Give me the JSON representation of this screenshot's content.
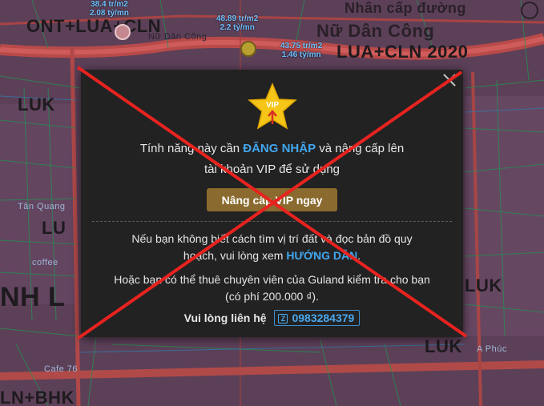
{
  "map": {
    "zone_labels": {
      "ont_lua_cln": "ONT+LUA+CLN",
      "lua_cln_2020": "LUA+CLN 2020",
      "luk_left": "LUK",
      "luk_right": "LUK",
      "luk_left_mid": "LU",
      "luk_bottom": "LUK",
      "nh_l": "NH L",
      "ln_bhk": "LN+BHK"
    },
    "street_labels": {
      "nu_dan_cong": "Nữ Dân Công",
      "nu_dan_cong_small": "Nữ Dân Công",
      "nhan_cap_duong": "Nhân cấp đường",
      "tan_quang": "Tân Quang",
      "cafe_76": "Cafe 76",
      "coffee": "coffee",
      "phuc": "A Phúc"
    },
    "prices": [
      {
        "per_m2": "38.4 tr/m2",
        "total": "2.08 tỷ/mn"
      },
      {
        "per_m2": "48.89 tr/m2",
        "total": "2.2 tỷ/mn"
      },
      {
        "per_m2": "43.75 tr/m2",
        "total": "1.46 tỷ/mn"
      }
    ]
  },
  "modal": {
    "vip_badge": "VIP",
    "message_prefix": "Tính năng này cần ",
    "login_link": "ĐĂNG NHẬP",
    "message_middle": " và nâng cấp lên",
    "message_line2": "tài khoản VIP để sử dụng",
    "upgrade_button": "Nâng cấp VIP ngay",
    "info_line1": "Nếu bạn không biết cách tìm vị trí đất và đọc bản đồ quy",
    "info_line2_prefix": "hoạch, vui lòng xem ",
    "guide_link": "HƯỚNG DẪN",
    "info_line2_suffix": ".",
    "info_line3": "Hoặc bạn có thể thuê chuyên viên của Guland kiểm tra cho bạn",
    "info_line4": "(có phí 200.000 ₫).",
    "contact_label": "Vui lòng liên hệ",
    "zalo_icon_label": "Z",
    "phone": "0983284379"
  },
  "colors": {
    "link": "#41a7ef",
    "upgrade_button_bg": "#8a6a2e",
    "modal_bg": "#232222",
    "cross_mark": "#e8231f",
    "map_zone": "#5b3f56"
  }
}
